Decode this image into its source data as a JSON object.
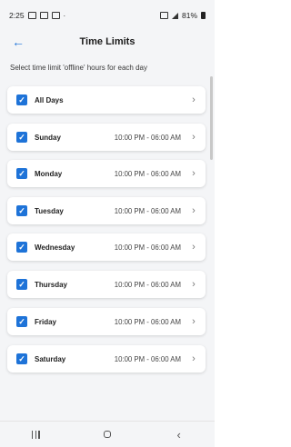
{
  "status_bar": {
    "time": "2:25",
    "battery": "81%"
  },
  "header": {
    "title": "Time Limits",
    "back_icon": "arrow-left-icon"
  },
  "subtitle": "Select time limit 'offline' hours for each day",
  "colors": {
    "accent": "#1e73d8",
    "background": "#f4f5f7"
  },
  "days": [
    {
      "label": "All Days",
      "time": "",
      "checked": true
    },
    {
      "label": "Sunday",
      "time": "10:00 PM - 06:00 AM",
      "checked": true
    },
    {
      "label": "Monday",
      "time": "10:00 PM - 06:00 AM",
      "checked": true
    },
    {
      "label": "Tuesday",
      "time": "10:00 PM - 06:00 AM",
      "checked": true
    },
    {
      "label": "Wednesday",
      "time": "10:00 PM - 06:00 AM",
      "checked": true
    },
    {
      "label": "Thursday",
      "time": "10:00 PM - 06:00 AM",
      "checked": true
    },
    {
      "label": "Friday",
      "time": "10:00 PM - 06:00 AM",
      "checked": true
    },
    {
      "label": "Saturday",
      "time": "10:00 PM - 06:00 AM",
      "checked": true
    }
  ],
  "nav": {
    "recents_icon": "recents-icon",
    "home_icon": "home-icon",
    "back_icon": "back-icon"
  }
}
